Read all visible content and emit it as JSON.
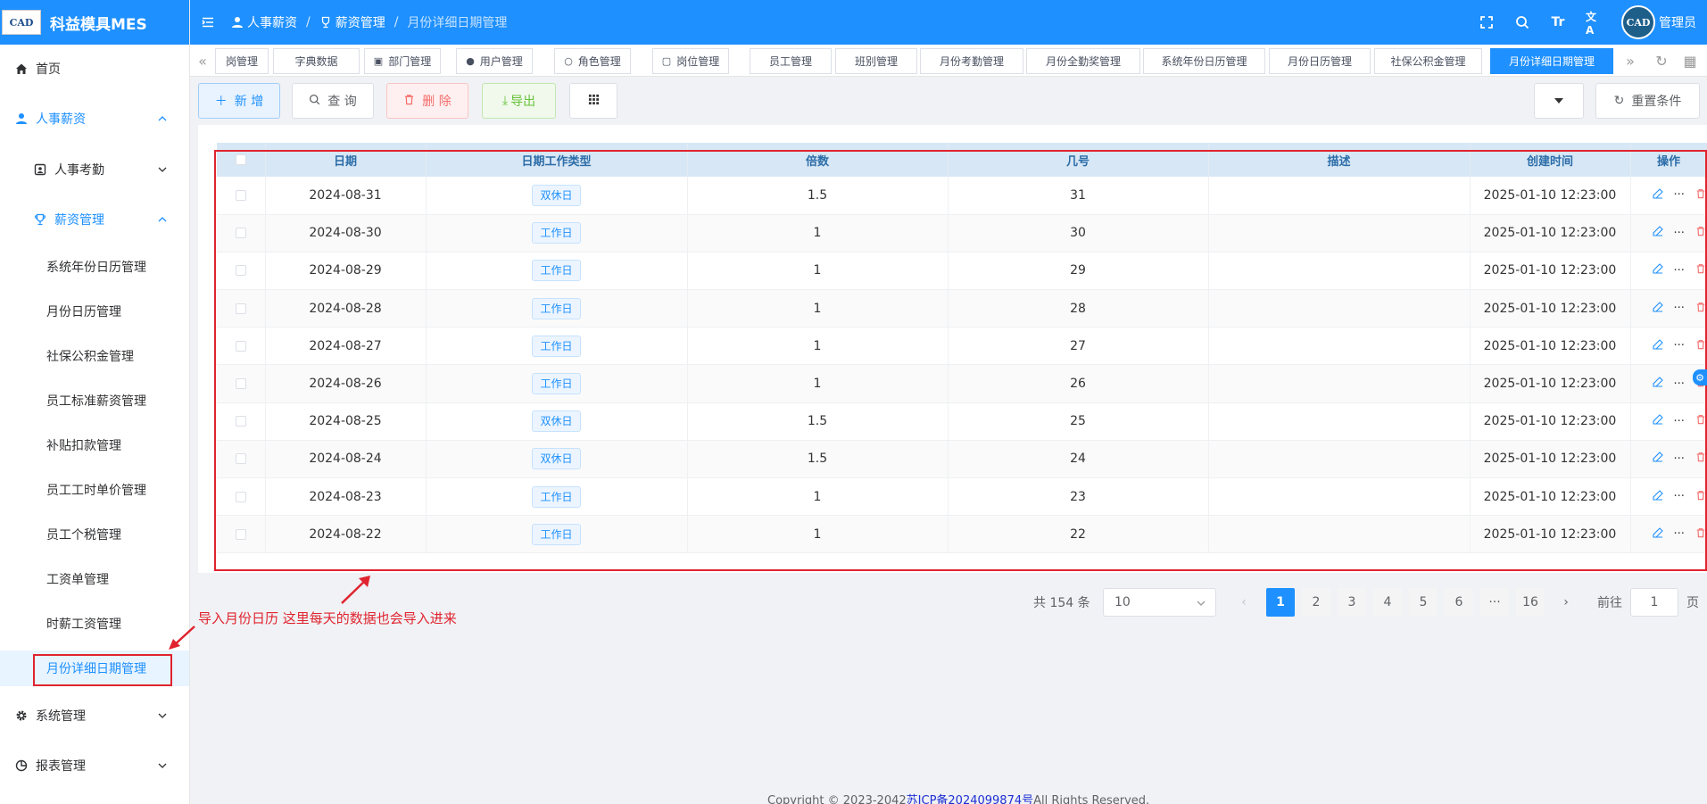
{
  "app": {
    "logo_mark": "CAD",
    "title": "科益模具MES"
  },
  "sidebar": {
    "home": "首页",
    "hr_salary": "人事薪资",
    "hr_attendance": "人事考勤",
    "salary_mgmt": "薪资管理",
    "sub_items": [
      "系统年份日历管理",
      "月份日历管理",
      "社保公积金管理",
      "员工标准薪资管理",
      "补贴扣款管理",
      "员工工时单价管理",
      "员工个税管理",
      "工资单管理",
      "时薪工资管理",
      "月份详细日期管理"
    ],
    "system_mgmt": "系统管理",
    "report_mgmt": "报表管理"
  },
  "header": {
    "breadcrumb": [
      "人事薪资",
      "薪资管理",
      "月份详细日期管理"
    ],
    "avatar_text": "CAD",
    "username": "管理员",
    "font_icon_text": "Tr",
    "lang_icon_text": "文A"
  },
  "tabs": [
    "岗管理",
    "字典数据",
    "部门管理",
    "用户管理",
    "角色管理",
    "岗位管理",
    "员工管理",
    "班别管理",
    "月份考勤管理",
    "月份全勤奖管理",
    "系统年份日历管理",
    "月份日历管理",
    "社保公积金管理",
    "月份详细日期管理"
  ],
  "toolbar": {
    "add": "新 增",
    "query": "查 询",
    "delete": "删 除",
    "export": "导出",
    "reset": "重置条件"
  },
  "table": {
    "headers": [
      "日期",
      "日期工作类型",
      "倍数",
      "几号",
      "描述",
      "创建时间",
      "操作"
    ],
    "rows": [
      {
        "date": "2024-08-31",
        "type": "双休日",
        "multiple": "1.5",
        "day": "31",
        "desc": "",
        "created": "2025-01-10 12:23:00"
      },
      {
        "date": "2024-08-30",
        "type": "工作日",
        "multiple": "1",
        "day": "30",
        "desc": "",
        "created": "2025-01-10 12:23:00"
      },
      {
        "date": "2024-08-29",
        "type": "工作日",
        "multiple": "1",
        "day": "29",
        "desc": "",
        "created": "2025-01-10 12:23:00"
      },
      {
        "date": "2024-08-28",
        "type": "工作日",
        "multiple": "1",
        "day": "28",
        "desc": "",
        "created": "2025-01-10 12:23:00"
      },
      {
        "date": "2024-08-27",
        "type": "工作日",
        "multiple": "1",
        "day": "27",
        "desc": "",
        "created": "2025-01-10 12:23:00"
      },
      {
        "date": "2024-08-26",
        "type": "工作日",
        "multiple": "1",
        "day": "26",
        "desc": "",
        "created": "2025-01-10 12:23:00"
      },
      {
        "date": "2024-08-25",
        "type": "双休日",
        "multiple": "1.5",
        "day": "25",
        "desc": "",
        "created": "2025-01-10 12:23:00"
      },
      {
        "date": "2024-08-24",
        "type": "双休日",
        "multiple": "1.5",
        "day": "24",
        "desc": "",
        "created": "2025-01-10 12:23:00"
      },
      {
        "date": "2024-08-23",
        "type": "工作日",
        "multiple": "1",
        "day": "23",
        "desc": "",
        "created": "2025-01-10 12:23:00"
      },
      {
        "date": "2024-08-22",
        "type": "工作日",
        "multiple": "1",
        "day": "22",
        "desc": "",
        "created": "2025-01-10 12:23:00"
      }
    ]
  },
  "pagination": {
    "total": "共 154 条",
    "page_size": "10",
    "pages": [
      "1",
      "2",
      "3",
      "4",
      "5",
      "6",
      "···",
      "16"
    ],
    "current": "1",
    "goto_label": "前往",
    "goto_value": "1",
    "page_suffix": "页"
  },
  "annotation": "导入月份日历 这里每天的数据也会导入进来",
  "footer": {
    "prefix": "Copyright © 2023-2042",
    "icp": "苏ICP备2024099874号",
    "suffix": "All Rights Reserved."
  },
  "colors": {
    "primary": "#1e90ff",
    "danger": "#f56c6c",
    "success": "#67c23a",
    "annotation": "#e0242f"
  }
}
